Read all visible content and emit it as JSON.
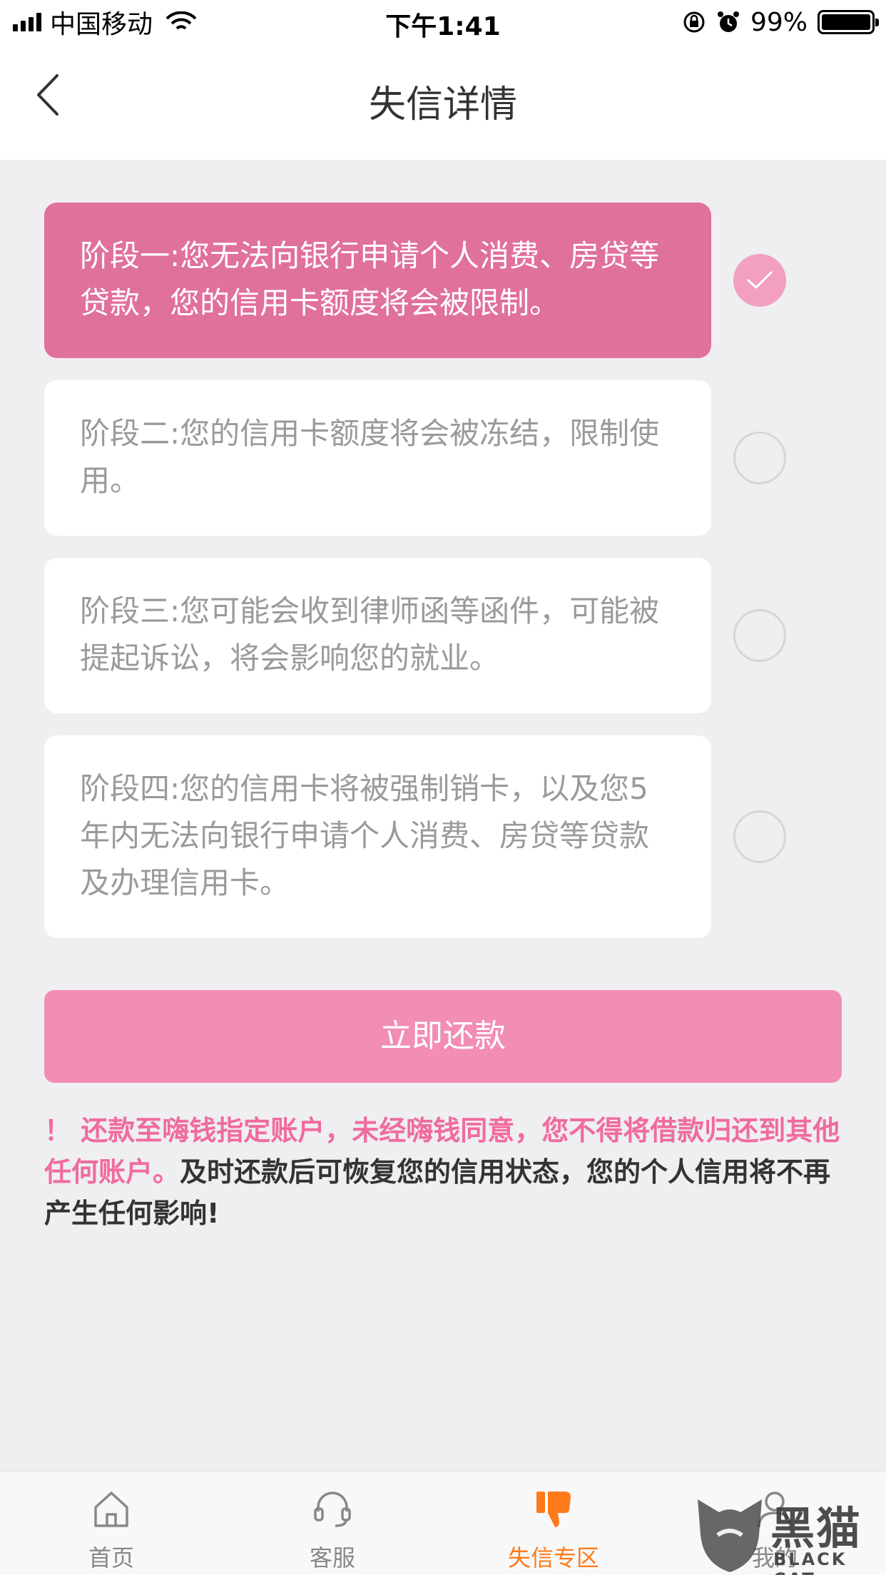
{
  "status_bar": {
    "carrier": "中国移动",
    "time": "下午1:41",
    "battery": "99%"
  },
  "nav": {
    "title": "失信详情"
  },
  "stages": [
    {
      "text": "阶段一:您无法向银行申请个人消费、房贷等贷款，您的信用卡额度将会被限制。",
      "selected": true
    },
    {
      "text": "阶段二:您的信用卡额度将会被冻结，限制使用。",
      "selected": false
    },
    {
      "text": "阶段三:您可能会收到律师函等函件，可能被提起诉讼，将会影响您的就业。",
      "selected": false
    },
    {
      "text": "阶段四:您的信用卡将被强制销卡，以及您5年内无法向银行申请个人消费、房贷等贷款及办理信用卡。",
      "selected": false
    }
  ],
  "pay_button": {
    "label": "立即还款"
  },
  "notice": {
    "warning": "！ 还款至嗨钱指定账户，未经嗨钱同意，您不得将借款归还到其他任何账户。",
    "normal": "及时还款后可恢复您的信用状态，您的个人信用将不再产生任何影响!"
  },
  "tabs": [
    {
      "label": "首页",
      "icon": "home-icon",
      "active": false
    },
    {
      "label": "客服",
      "icon": "headset-icon",
      "active": false
    },
    {
      "label": "失信专区",
      "icon": "thumbs-down-icon",
      "active": true
    },
    {
      "label": "我的",
      "icon": "user-icon",
      "active": false
    }
  ],
  "watermark": {
    "text": "黑猫",
    "sub": "BLACK CAT"
  },
  "colors": {
    "active_card": "#e0709c",
    "pay_button": "#f28db4",
    "warning_text": "#f06b9e",
    "active_tab": "#ff7a1a"
  }
}
